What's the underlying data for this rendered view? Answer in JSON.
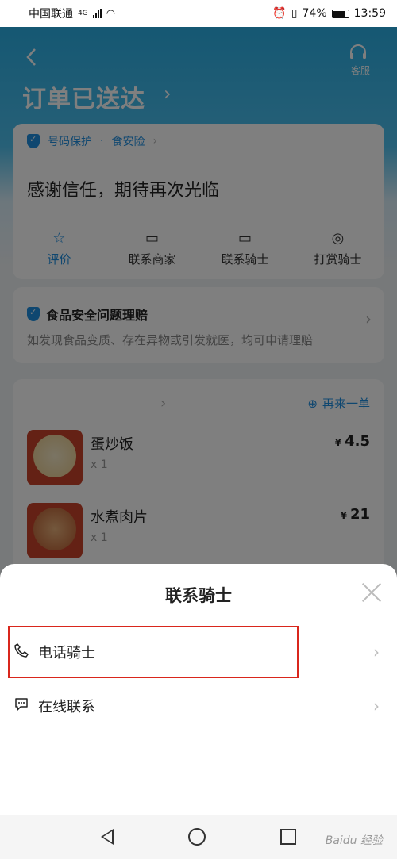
{
  "status_bar": {
    "carrier": "中国联通",
    "network": "4G",
    "battery": "74%",
    "time": "13:59"
  },
  "header": {
    "back_icon": "chevron-left-icon",
    "service_label": "客服",
    "title": "订单已送达"
  },
  "protection": {
    "tag1": "号码保护",
    "tag2": "食安险",
    "message": "感谢信任，期待再次光临",
    "actions": [
      {
        "label": "评价",
        "icon": "star-icon"
      },
      {
        "label": "联系商家",
        "icon": "chat-icon"
      },
      {
        "label": "联系骑士",
        "icon": "chat-icon"
      },
      {
        "label": "打赏骑士",
        "icon": "money-bag-icon"
      }
    ]
  },
  "food_safety": {
    "title": "食品安全问题理赔",
    "desc": "如发现食品变质、存在异物或引发就医，均可申请理赔"
  },
  "order": {
    "reorder_label": "再来一单",
    "items": [
      {
        "name": "蛋炒饭",
        "qty": "x 1",
        "currency": "¥",
        "price": "4.5"
      },
      {
        "name": "水煮肉片",
        "qty": "x 1",
        "currency": "¥",
        "price": "21"
      }
    ]
  },
  "sheet": {
    "title": "联系骑士",
    "options": [
      {
        "label": "电话骑士",
        "icon": "phone-icon"
      },
      {
        "label": "在线联系",
        "icon": "chat-icon"
      }
    ]
  },
  "watermark": "Baidu 经验",
  "colors": {
    "accent": "#1f8fe0",
    "highlight": "#d9261c"
  }
}
